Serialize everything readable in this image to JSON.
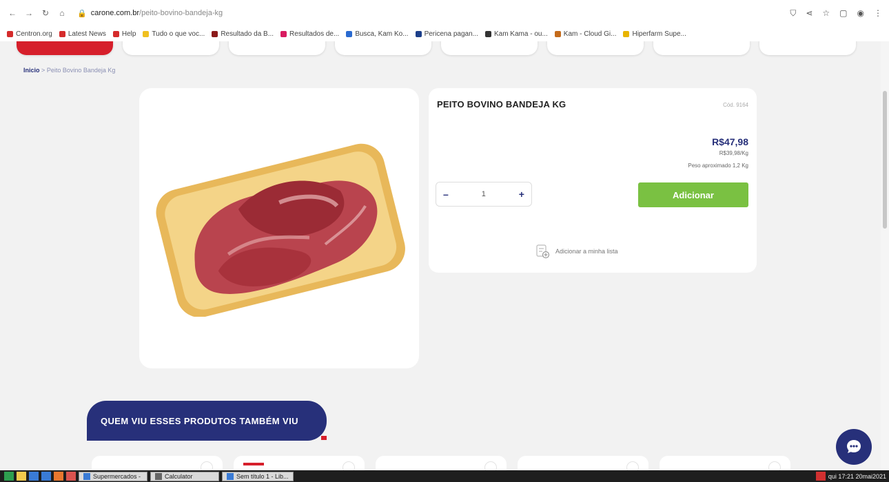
{
  "browser": {
    "address_host": "carone.com.br",
    "address_path": "/peito-bovino-bandeja-kg",
    "bookmarks": [
      {
        "label": "Centron.org",
        "color": "#d52b2b"
      },
      {
        "label": "Latest News",
        "color": "#d52b2b"
      },
      {
        "label": "Help",
        "color": "#d52b2b"
      },
      {
        "label": "Tudo o que voc...",
        "color": "#f0c020"
      },
      {
        "label": "Resultado da B...",
        "color": "#8b1a1a"
      },
      {
        "label": "Resultados de...",
        "color": "#d81b60"
      },
      {
        "label": "Busca, Kam Ko...",
        "color": "#2a6ad0"
      },
      {
        "label": "Pericena pagan...",
        "color": "#1c3f8a"
      },
      {
        "label": "Kam Kama - ou...",
        "color": "#333333"
      },
      {
        "label": "Kam - Cloud Gi...",
        "color": "#c46b1b"
      },
      {
        "label": "Hiperfarm Supe...",
        "color": "#e8b400"
      }
    ]
  },
  "breadcrumb": {
    "home": "Inicio",
    "separator": ">",
    "current": "Peito Bovino Bandeja Kg"
  },
  "product": {
    "title": "PEITO BOVINO BANDEJA KG",
    "code": "Cód. 9164",
    "price": "R$47,98",
    "unit_price": "R$39,98/Kg",
    "approx_weight": "Peso aproximado 1,2 Kg",
    "quantity": "1",
    "minus": "–",
    "plus": "+",
    "add_button": "Adicionar",
    "add_to_list": "Adicionar a minha lista"
  },
  "section": {
    "title": "QUEM VIU ESSES PRODUTOS TAMBÉM VIU"
  },
  "colors": {
    "brand_blue": "#27307a",
    "brand_red": "#d61f2b",
    "add_green": "#7ac142"
  },
  "taskbar": {
    "windows": [
      "Supermercados -",
      "Calculator",
      "Sem título 1 - Lib..."
    ],
    "clock": "qui 17:21 20mai2021"
  }
}
